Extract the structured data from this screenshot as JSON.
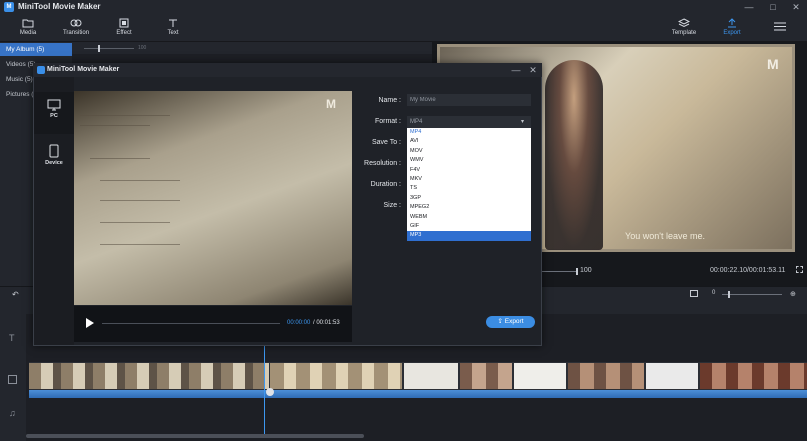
{
  "app": {
    "title": "MiniTool Movie Maker",
    "logo": "M"
  },
  "window_controls": {
    "minimize": "—",
    "maximize": "□",
    "close": "✕"
  },
  "toolbar": {
    "media": "Media",
    "transition": "Transition",
    "effect": "Effect",
    "text": "Text",
    "template": "Template",
    "export": "Export"
  },
  "albums": [
    {
      "label": "My Album (5)"
    },
    {
      "label": "Videos (5)"
    },
    {
      "label": "Music (5)"
    },
    {
      "label": "Pictures ("
    }
  ],
  "media_zoom": {
    "value": "100"
  },
  "preview": {
    "subtitle": "You won't leave me.",
    "logo": "M",
    "volume": "100",
    "time": "00:00:22.10/00:01:53.11"
  },
  "timeline": {
    "zoom_value": "0"
  },
  "dialog": {
    "title": "MiniTool Movie Maker",
    "devices": [
      {
        "label": "PC"
      },
      {
        "label": "Device"
      }
    ],
    "preview_logo": "M",
    "current_time": "00:00:00",
    "total_time": "/ 00:01:53",
    "name_label": "Name :",
    "name_value": "My Movie",
    "format_label": "Format :",
    "format_value": "MP4",
    "save_to_label": "Save To :",
    "resolution_label": "Resolution :",
    "duration_label": "Duration :",
    "size_label": "Size :",
    "format_options": [
      "MP4",
      "AVI",
      "MOV",
      "WMV",
      "F4V",
      "MKV",
      "TS",
      "3GP",
      "MPEG2",
      "WEBM",
      "GIF",
      "MP3"
    ],
    "selected_option": "MP3",
    "export_button": "Export"
  },
  "colors": {
    "accent": "#3d97f0",
    "album_active": "#3773c6",
    "export_button": "#3b8de3"
  }
}
